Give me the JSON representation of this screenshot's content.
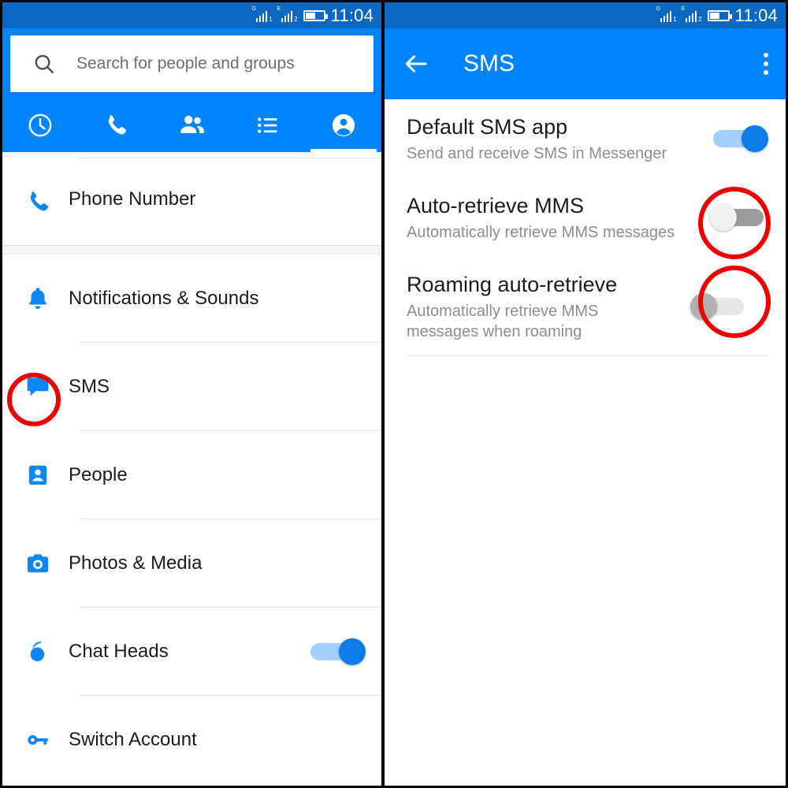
{
  "status_bar": {
    "signal1": {
      "network_label": "G",
      "sim_index": "1"
    },
    "signal2": {
      "network_label": "E",
      "sim_index": "2"
    },
    "time": "11:04"
  },
  "colors": {
    "brand_blue": "#0084ff",
    "status_bar_blue": "#0a68c2",
    "annotation_red": "#ee0000",
    "switch_on_thumb": "#0d7ceb",
    "switch_on_track": "#a5d0ff",
    "icon_blue": "#0e86f5"
  },
  "left_panel": {
    "search": {
      "placeholder": "Search for people and groups",
      "value": "",
      "icon": "search-icon"
    },
    "tabs": [
      {
        "name": "recent",
        "icon": "clock-icon",
        "active": false
      },
      {
        "name": "calls",
        "icon": "phone-icon",
        "active": false
      },
      {
        "name": "people",
        "icon": "group-icon",
        "active": false
      },
      {
        "name": "lists",
        "icon": "list-icon",
        "active": false
      },
      {
        "name": "profile",
        "icon": "person-icon",
        "active": true
      }
    ],
    "settings": [
      {
        "label": "Phone Number",
        "sublabel": "",
        "icon": "phone-icon",
        "has_toggle": false,
        "annotated": false
      },
      {
        "label": "Notifications & Sounds",
        "sublabel": "",
        "icon": "bell-icon",
        "has_toggle": false,
        "annotated": false
      },
      {
        "label": "SMS",
        "sublabel": "",
        "icon": "chat-bubble-icon",
        "has_toggle": false,
        "annotated": true
      },
      {
        "label": "People",
        "sublabel": "",
        "icon": "contact-card-icon",
        "has_toggle": false,
        "annotated": false
      },
      {
        "label": "Photos & Media",
        "sublabel": "",
        "icon": "camera-icon",
        "has_toggle": false,
        "annotated": false
      },
      {
        "label": "Chat Heads",
        "sublabel": "",
        "icon": "chat-head-icon",
        "has_toggle": true,
        "toggle_state": "on",
        "annotated": false
      },
      {
        "label": "Switch Account",
        "sublabel": "",
        "icon": "key-icon",
        "has_toggle": false,
        "annotated": false
      }
    ]
  },
  "right_panel": {
    "appbar": {
      "back_icon": "back-arrow-icon",
      "title": "SMS",
      "overflow_icon": "kebab-menu-icon"
    },
    "preferences": [
      {
        "title": "Default SMS app",
        "subtitle": "Send and receive SMS in Messenger",
        "toggle_state": "on",
        "annotated": false
      },
      {
        "title": "Auto-retrieve MMS",
        "subtitle": "Automatically retrieve MMS messages",
        "toggle_state": "off",
        "annotated": true
      },
      {
        "title": "Roaming auto-retrieve",
        "subtitle": "Automatically retrieve MMS messages when roaming",
        "toggle_state": "off",
        "annotated": true
      }
    ]
  }
}
